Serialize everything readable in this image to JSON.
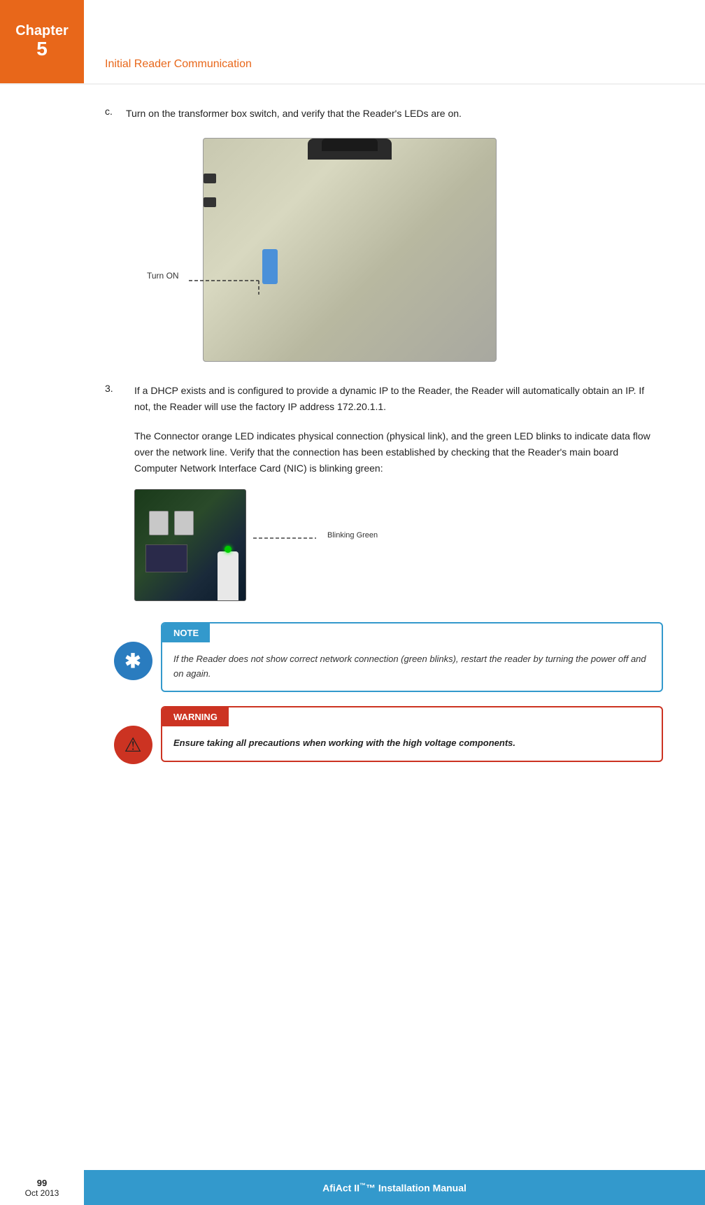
{
  "header": {
    "chapter_word": "Chapter",
    "chapter_num": "5",
    "title": "Initial Reader Communication"
  },
  "step_c": {
    "label": "c.",
    "text": "Turn on the transformer box switch, and verify that the Reader's LEDs are on."
  },
  "transformer": {
    "turn_on_label": "Turn ON"
  },
  "step_3": {
    "num": "3.",
    "text": "If a DHCP exists and is configured to provide a dynamic IP to the Reader, the Reader will automatically obtain an IP. If not, the Reader will use the factory IP address 172.20.1.1."
  },
  "para_2": {
    "text": "The Connector orange LED indicates physical connection (physical link), and the green LED blinks to indicate data flow over the network line. Verify that the connection has been established by checking that the Reader's main board Computer Network Interface Card (NIC) is blinking green:"
  },
  "nic": {
    "callout": "Blinking Green"
  },
  "note": {
    "header": "NOTE",
    "body": "If the Reader does not show correct network connection (green blinks), restart the reader by turning the power off and on again."
  },
  "warning": {
    "header": "WARNING",
    "body": "Ensure taking all precautions when working with the high voltage components."
  },
  "footer": {
    "page": "99",
    "date": "Oct 2013",
    "center_text": "AfiAct II",
    "center_suffix": "™ Installation Manual"
  }
}
